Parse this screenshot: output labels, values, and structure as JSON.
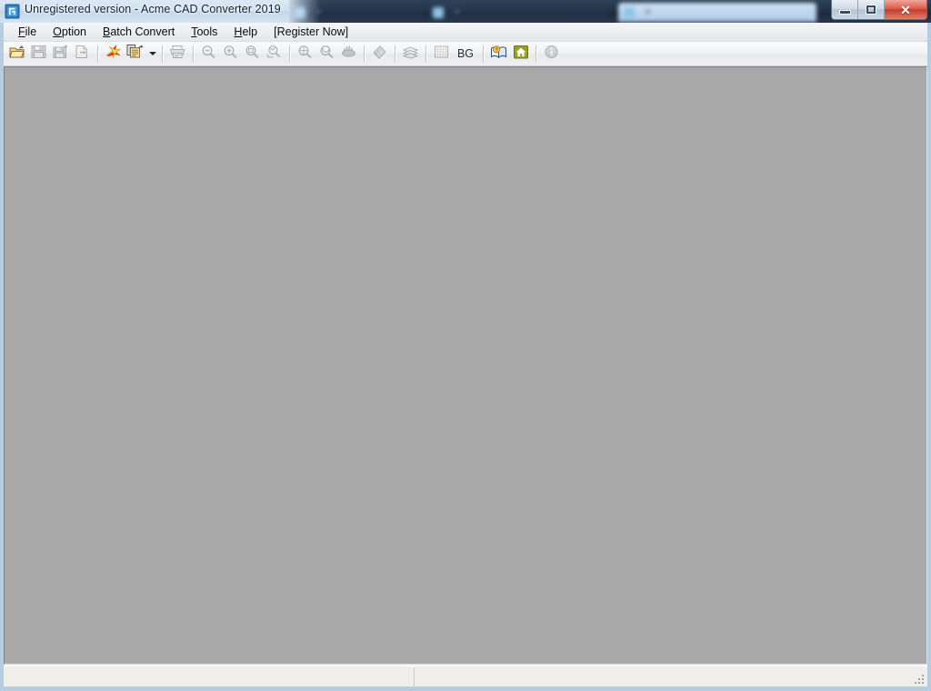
{
  "window": {
    "title": "Unregistered version - Acme CAD Converter 2019",
    "app_icon": "cad-document-icon",
    "controls": {
      "minimize_label": "–",
      "maximize_label": "❑",
      "close_label": "✕"
    }
  },
  "background": {
    "tabs": [
      {
        "title": "",
        "state": "inactive",
        "close_label": "✕"
      },
      {
        "title": "",
        "state": "inactive",
        "close_label": "✕"
      },
      {
        "title": "",
        "state": "active",
        "close_label": "✕"
      }
    ]
  },
  "menubar": {
    "items": [
      {
        "label": "File",
        "accel": "F"
      },
      {
        "label": "Option",
        "accel": "O"
      },
      {
        "label": "Batch Convert",
        "accel": "B"
      },
      {
        "label": "Tools",
        "accel": "T"
      },
      {
        "label": "Help",
        "accel": "H"
      },
      {
        "label": "[Register Now]",
        "accel": ""
      }
    ]
  },
  "toolbar": {
    "buttons": [
      {
        "name": "open-file-button",
        "icon": "open-folder-icon",
        "label": "Open",
        "enabled": true
      },
      {
        "name": "save-button",
        "icon": "save-disk-icon",
        "label": "Save",
        "enabled": false
      },
      {
        "name": "save-as-button",
        "icon": "save-as-disk-icon",
        "label": "Save As",
        "enabled": false
      },
      {
        "name": "export-button",
        "icon": "export-file-icon",
        "label": "Export",
        "enabled": false
      },
      {
        "name": "separator-1",
        "icon": "separator",
        "label": "",
        "enabled": true
      },
      {
        "name": "convert-button",
        "icon": "convert-burst-icon",
        "label": "Convert",
        "enabled": true
      },
      {
        "name": "batch-convert-button",
        "icon": "batch-pages-icon",
        "label": "Batch Convert",
        "enabled": true
      },
      {
        "name": "batch-convert-dropdown",
        "icon": "chevron-down-icon",
        "label": "",
        "enabled": true
      },
      {
        "name": "separator-2",
        "icon": "separator",
        "label": "",
        "enabled": true
      },
      {
        "name": "print-button",
        "icon": "printer-icon",
        "label": "Print",
        "enabled": false
      },
      {
        "name": "separator-3",
        "icon": "separator",
        "label": "",
        "enabled": true
      },
      {
        "name": "zoom-out-button",
        "icon": "zoom-out-icon",
        "label": "Zoom Out",
        "enabled": false
      },
      {
        "name": "zoom-in-button",
        "icon": "zoom-in-icon",
        "label": "Zoom In",
        "enabled": false
      },
      {
        "name": "zoom-window-button",
        "icon": "zoom-window-icon",
        "label": "Zoom Window",
        "enabled": false
      },
      {
        "name": "zoom-extents-button",
        "icon": "zoom-extents-icon",
        "label": "Zoom Extents",
        "enabled": false
      },
      {
        "name": "separator-4",
        "icon": "separator",
        "label": "",
        "enabled": true
      },
      {
        "name": "zoom-all-button",
        "icon": "zoom-all-icon",
        "label": "Zoom All",
        "enabled": false
      },
      {
        "name": "zoom-previous-button",
        "icon": "zoom-previous-icon",
        "label": "Zoom Previous",
        "enabled": false
      },
      {
        "name": "pan-button",
        "icon": "pan-hand-icon",
        "label": "Pan",
        "enabled": false
      },
      {
        "name": "separator-5",
        "icon": "separator",
        "label": "",
        "enabled": true
      },
      {
        "name": "measure-button",
        "icon": "measure-icon",
        "label": "Measure",
        "enabled": false
      },
      {
        "name": "separator-6",
        "icon": "separator",
        "label": "",
        "enabled": true
      },
      {
        "name": "layers-button",
        "icon": "layers-icon",
        "label": "Layers",
        "enabled": false
      },
      {
        "name": "separator-7",
        "icon": "separator",
        "label": "",
        "enabled": true
      },
      {
        "name": "grid-button",
        "icon": "grid-icon",
        "label": "Grid",
        "enabled": false
      },
      {
        "name": "background-button",
        "icon": "bg-text-icon",
        "label": "BG",
        "enabled": true
      },
      {
        "name": "separator-8",
        "icon": "separator",
        "label": "",
        "enabled": true
      },
      {
        "name": "help-button",
        "icon": "help-book-icon",
        "label": "Help",
        "enabled": true
      },
      {
        "name": "home-button",
        "icon": "home-icon",
        "label": "Home",
        "enabled": true
      },
      {
        "name": "separator-9",
        "icon": "separator",
        "label": "",
        "enabled": true
      },
      {
        "name": "about-button",
        "icon": "info-icon",
        "label": "About",
        "enabled": false
      }
    ],
    "bg_label": "BG"
  },
  "statusbar": {
    "main_text": "",
    "info_text": "",
    "grip": "resize-grip"
  },
  "canvas": {
    "background_color": "#a8a8a8",
    "content": ""
  },
  "colors": {
    "title_glass": "#cfdff0",
    "frame": "#b6cde1",
    "canvas": "#a8a8a8",
    "close_button": "#c23d2b",
    "accent_yellow": "#e8b23a",
    "status_bar": "#f0eeea"
  }
}
